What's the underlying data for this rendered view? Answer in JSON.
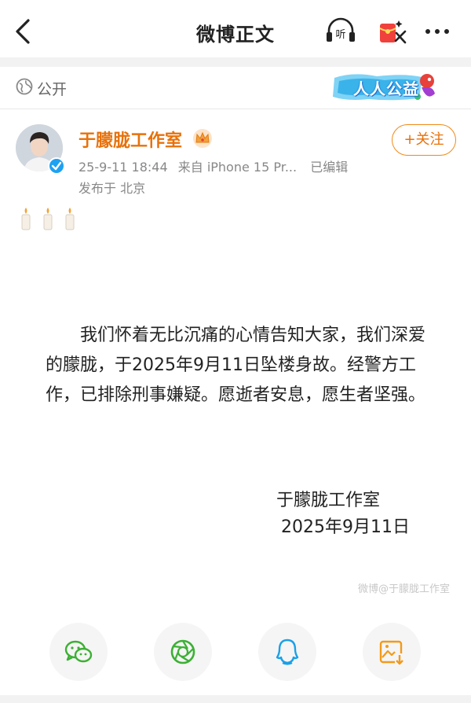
{
  "header": {
    "title": "微博正文",
    "listen_label": "听"
  },
  "visibility": {
    "label": "公开",
    "badge_text": "人人公益"
  },
  "author": {
    "name": "于朦胧工作室",
    "timestamp": "25-9-11 18:44",
    "source": "来自 iPhone 15 Pr...",
    "edited": "已编辑",
    "location": "发布于 北京",
    "follow_label": "+关注"
  },
  "post": {
    "candles": "🕯️🕯️🕯️",
    "statement": "我们怀着无比沉痛的心情告知大家，我们深爱的朦胧，于2025年9月11日坠楼身故。经警方工作，已排除刑事嫌疑。愿逝者安息，愿生者坚强。",
    "signature_name": "于朦胧工作室",
    "signature_date": "2025年9月11日",
    "watermark": "微博@于朦胧工作室"
  },
  "share": {
    "icons": [
      "wechat-icon",
      "moments-icon",
      "qq-icon",
      "save-image-icon"
    ]
  },
  "colors": {
    "accent": "#e8710a",
    "verified": "#1da1f2",
    "wechat": "#3cb034",
    "qq": "#1aa0e8",
    "save": "#f29a1a"
  }
}
